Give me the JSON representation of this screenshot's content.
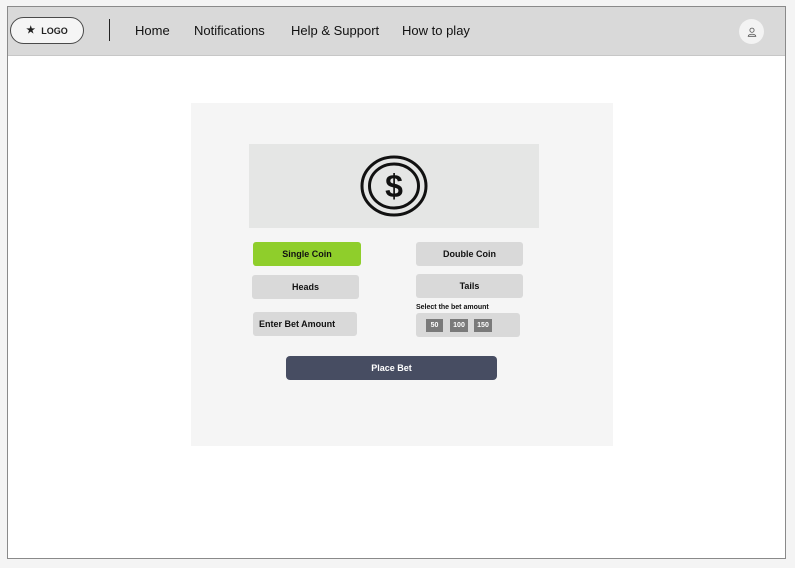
{
  "header": {
    "logo_label": "LOGO",
    "nav": [
      "Home",
      "Notifications",
      "Help & Support",
      "How to play"
    ]
  },
  "game": {
    "coin_icon": "dollar-coin-icon",
    "mode_single": "Single Coin",
    "mode_double": "Double Coin",
    "mode_selected": "Single Coin",
    "side_heads": "Heads",
    "side_tails": "Tails",
    "bet_placeholder": "Enter Bet Amount",
    "amount_label": "Select the bet amount",
    "amounts": [
      "50",
      "100",
      "150"
    ],
    "place_bet": "Place Bet"
  },
  "colors": {
    "accent_green": "#8fce2b",
    "place_bet_bg": "#474d62",
    "topbar_bg": "#d9d9d9"
  }
}
